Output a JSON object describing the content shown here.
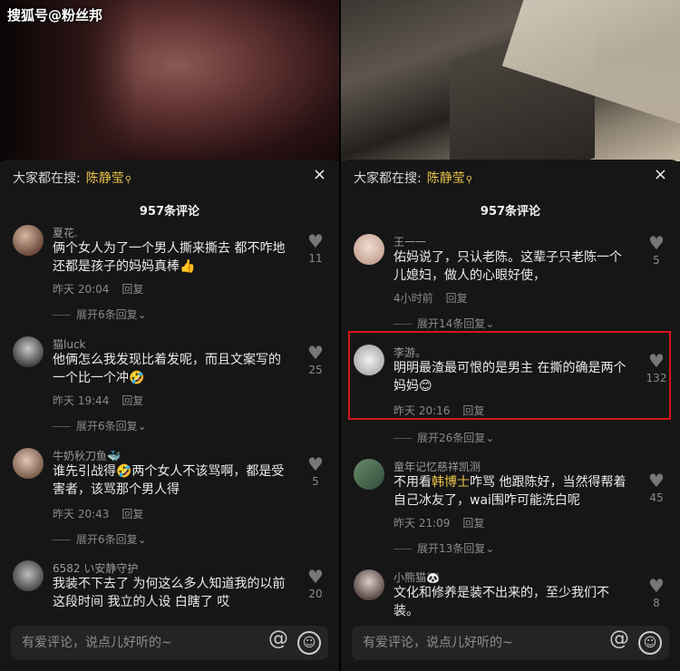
{
  "watermark": "搜狐号@粉丝邦",
  "left": {
    "search_prefix": "大家都在搜:",
    "search_term": "陈静莹",
    "close": "×",
    "comment_count": "957条评论",
    "comments": [
      {
        "user": "夏花.",
        "text": "俩个女人为了一个男人撕来撕去 都不咋地还都是孩子的妈妈真棒👍",
        "time": "昨天 20:04",
        "reply": "回复",
        "likes": "11",
        "expand": "展开6条回复"
      },
      {
        "user": "猫luck",
        "text": "他俩怎么我发现比着发呢，而且文案写的一个比一个冲🤣",
        "time": "昨天 19:44",
        "reply": "回复",
        "likes": "25",
        "expand": "展开6条回复"
      },
      {
        "user": "牛奶秋刀鱼🐳",
        "text": "谁先引战得🤣两个女人不该骂啊，都是受害者，该骂那个男人得",
        "time": "昨天 20:43",
        "reply": "回复",
        "likes": "5",
        "expand": "展开6条回复"
      },
      {
        "user": "6582 い安静守护",
        "text": "我装不下去了 为何这么多人知道我的以前 这段时间 我立的人设 白瞎了 哎",
        "likes": "20"
      }
    ],
    "input_placeholder": "有爱评论，说点儿好听的~"
  },
  "right": {
    "search_prefix": "大家都在搜:",
    "search_term": "陈静莹",
    "close": "×",
    "comment_count": "957条评论",
    "comments": [
      {
        "user": "王一一",
        "text": "佑妈说了，只认老陈。这辈子只老陈一个儿媳妇，做人的心眼好使，",
        "time": "4小时前",
        "reply": "回复",
        "likes": "5",
        "expand": "展开14条回复"
      },
      {
        "user": "李游。",
        "text": "明明最渣最可恨的是男主 在撕的确是两个妈妈😊",
        "time": "昨天 20:16",
        "reply": "回复",
        "likes": "132",
        "expand": "展开26条回复"
      },
      {
        "user": "童年记忆慈祥凯测",
        "text_a": "不用看",
        "text_b": "韩博士",
        "text_c": "咋骂 他跟陈好，当然得帮着自己冰友了，wai围咋可能洗白呢",
        "time": "昨天 21:09",
        "reply": "回复",
        "likes": "45",
        "expand": "展开13条回复"
      },
      {
        "user": "小熊猫🐼",
        "text": "文化和修养是装不出来的，至少我们不装。",
        "likes": "8"
      }
    ],
    "input_placeholder": "有爱评论，说点儿好听的~"
  },
  "icons": {
    "heart": "heart-icon",
    "at": "at-icon",
    "emoji": "emoji-icon",
    "close": "close-icon",
    "search": "search-icon"
  },
  "colors": {
    "accent_yellow": "#e8c24a",
    "highlight_red": "#d7141b",
    "sheet_bg": "#161616"
  }
}
